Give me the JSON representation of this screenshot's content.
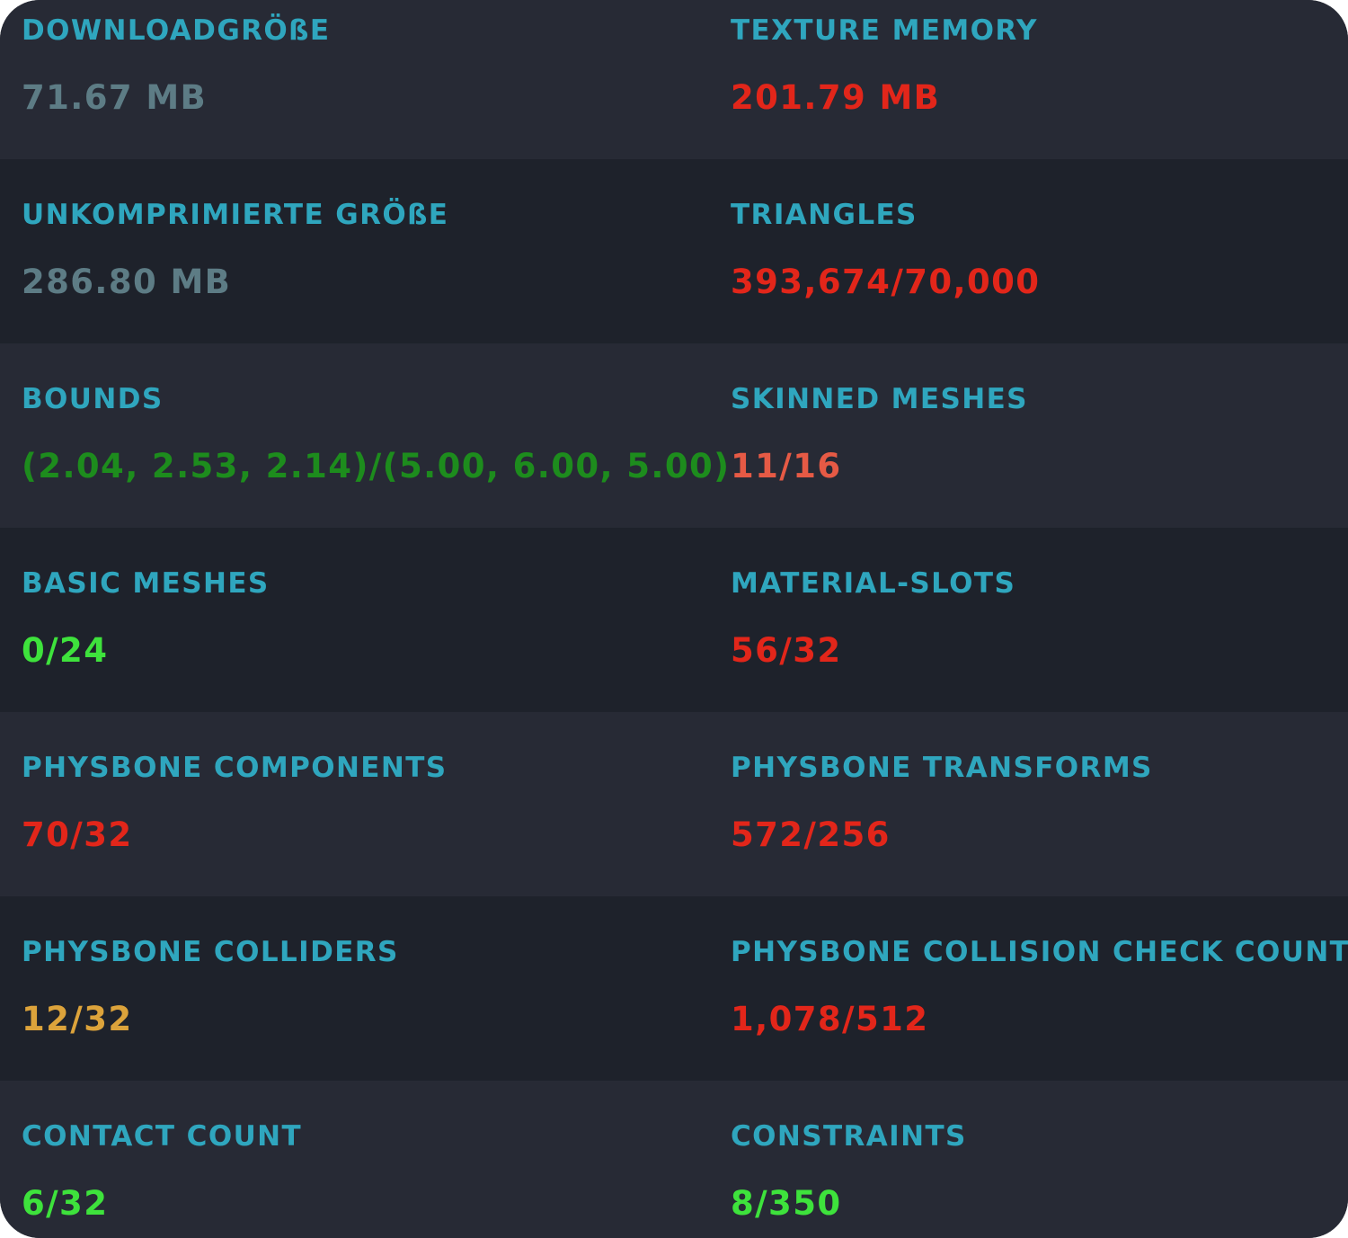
{
  "colors": {
    "label": "#2fa6be",
    "row_light": "#272a35",
    "row_dark": "#1e222b",
    "gray": "#5d7c85",
    "red": "#e2261a",
    "salmon": "#e65a45",
    "dark_green": "#1d8c1d",
    "green": "#3ee23c",
    "orange": "#dca33b"
  },
  "stats": [
    {
      "label": "DOWNLOADGRÖßE",
      "value": "71.67 MB",
      "status": "gray"
    },
    {
      "label": "TEXTURE MEMORY",
      "value": "201.79 MB",
      "status": "red"
    },
    {
      "label": "UNKOMPRIMIERTE GRÖßE",
      "value": "286.80 MB",
      "status": "gray"
    },
    {
      "label": "TRIANGLES",
      "value": "393,674/70,000",
      "status": "red"
    },
    {
      "label": "BOUNDS",
      "value": "(2.04, 2.53, 2.14)/(5.00, 6.00, 5.00)",
      "status": "dark_green"
    },
    {
      "label": "SKINNED MESHES",
      "value": "11/16",
      "status": "salmon"
    },
    {
      "label": "BASIC MESHES",
      "value": "0/24",
      "status": "green"
    },
    {
      "label": "MATERIAL-SLOTS",
      "value": "56/32",
      "status": "red"
    },
    {
      "label": "PHYSBONE COMPONENTS",
      "value": "70/32",
      "status": "red"
    },
    {
      "label": "PHYSBONE TRANSFORMS",
      "value": "572/256",
      "status": "red"
    },
    {
      "label": "PHYSBONE COLLIDERS",
      "value": "12/32",
      "status": "orange"
    },
    {
      "label": "PHYSBONE COLLISION CHECK COUNT",
      "value": "1,078/512",
      "status": "red"
    },
    {
      "label": "CONTACT COUNT",
      "value": "6/32",
      "status": "green"
    },
    {
      "label": "CONSTRAINTS",
      "value": "8/350",
      "status": "green"
    }
  ]
}
